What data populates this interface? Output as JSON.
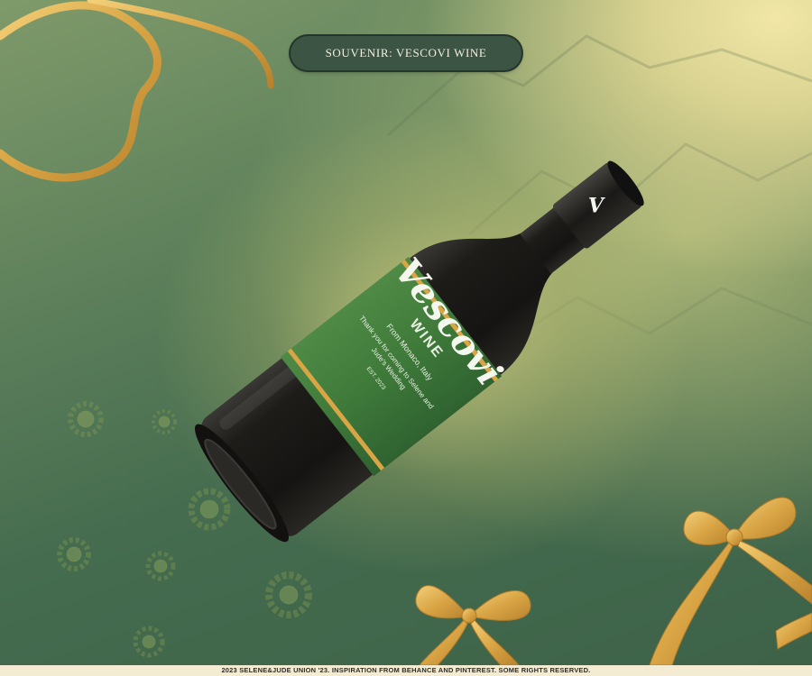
{
  "header": {
    "title": "SOUVENIR: VESCOVI WINE"
  },
  "label": {
    "brand": "Vescovi",
    "subbrand": "WINE",
    "origin": "From Monaco, Italy",
    "thanks_line1": "Thank you for coming to Selene and",
    "thanks_line2": "Jude's Wedding",
    "established": "EST. 2023",
    "cap_monogram": "V"
  },
  "footer": {
    "text": "2023 SELENE&JUDE UNION '23. INSPIRATION FROM BEHANCE AND PINTEREST. SOME RIGHTS RESERVED."
  },
  "colors": {
    "background_green": "#456c4f",
    "highlight_gold": "#f1e6a6",
    "ribbon_gold": "#e0b150",
    "label_green": "#3f7a3a",
    "bottle": "#1b1a17",
    "pill": "#3b5443"
  },
  "decorations": [
    "ribbon-swirl-top-left",
    "ribbon-bow-bottom-center",
    "ribbon-bow-bottom-right",
    "sunflower-watermarks",
    "mountain-sketch"
  ]
}
